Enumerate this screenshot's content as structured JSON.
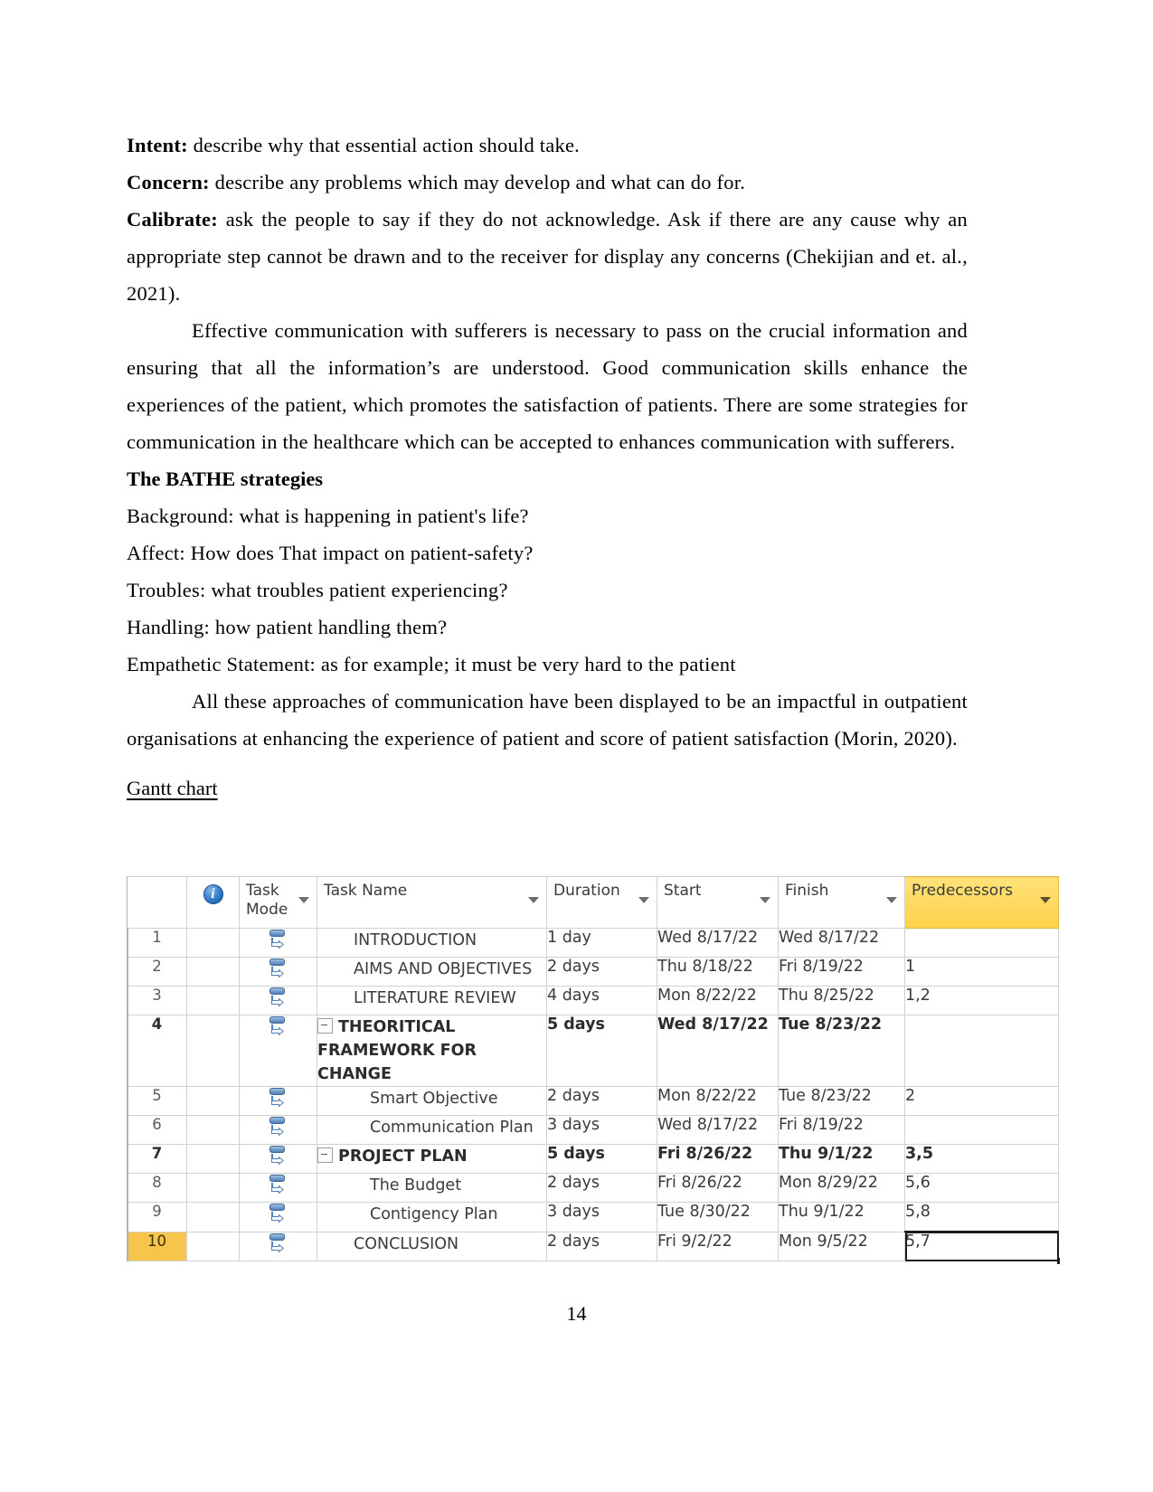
{
  "document": {
    "page_number": "14",
    "paragraphs": [
      {
        "label": "Intent:",
        "text": " describe why that essential action should take."
      },
      {
        "label": "Concern:",
        "text": " describe any problems which may develop and what can do for."
      },
      {
        "label": "Calibrate:",
        "text": " ask the people to say if they do not acknowledge. Ask if there are any cause why an appropriate step cannot be drawn and to the receiver for display any concerns (Chekijian and et. al., 2021)."
      }
    ],
    "body_paragraph_1": "Effective communication with sufferers is necessary to pass on the crucial information and ensuring that all the information’s are understood. Good communication skills enhance the experiences of the patient, which promotes the satisfaction of patients. There are some strategies for communication in the healthcare which can be accepted to enhances communication with sufferers.",
    "bathe_heading": "The BATHE strategies",
    "bathe_lines": [
      "Background: what is happening in patient's life?",
      "Affect: How does That impact on patient-safety?",
      "Troubles: what troubles patient experiencing?",
      "Handling: how patient handling them?",
      "Empathetic Statement: as for example; it must be very hard to the patient"
    ],
    "body_paragraph_2": "All these approaches of communication have been displayed to be an impactful in outpatient organisations at enhancing the experience of patient and score of patient satisfaction (Morin, 2020).",
    "gantt_label": "Gantt chart"
  },
  "project_table": {
    "columns": [
      {
        "key": "id",
        "label": ""
      },
      {
        "key": "indicator",
        "label": "",
        "icon": "info-icon"
      },
      {
        "key": "mode",
        "label": "Task\nMode",
        "has_filter": true
      },
      {
        "key": "name",
        "label": "Task Name",
        "has_filter": true
      },
      {
        "key": "duration",
        "label": "Duration",
        "has_filter": true
      },
      {
        "key": "start",
        "label": "Start",
        "has_filter": true
      },
      {
        "key": "finish",
        "label": "Finish",
        "has_filter": true
      },
      {
        "key": "predecessors",
        "label": "Predecessors",
        "has_filter": true,
        "highlight": "#ffd24a"
      }
    ],
    "rows": [
      {
        "id": "1",
        "name": "INTRODUCTION",
        "duration": "1 day",
        "start": "Wed 8/17/22",
        "finish": "Wed 8/17/22",
        "predecessors": "",
        "level": 1,
        "summary": false,
        "collapse": false
      },
      {
        "id": "2",
        "name": "AIMS AND OBJECTIVES",
        "duration": "2 days",
        "start": "Thu 8/18/22",
        "finish": "Fri 8/19/22",
        "predecessors": "1",
        "level": 1,
        "summary": false,
        "collapse": false
      },
      {
        "id": "3",
        "name": "LITERATURE REVIEW",
        "duration": "4 days",
        "start": "Mon 8/22/22",
        "finish": "Thu 8/25/22",
        "predecessors": "1,2",
        "level": 1,
        "summary": false,
        "collapse": false
      },
      {
        "id": "4",
        "name": "THEORITICAL FRAMEWORK FOR CHANGE",
        "duration": "5 days",
        "start": "Wed 8/17/22",
        "finish": "Tue 8/23/22",
        "predecessors": "",
        "level": 0,
        "summary": true,
        "collapse": true
      },
      {
        "id": "5",
        "name": "Smart Objective",
        "duration": "2 days",
        "start": "Mon 8/22/22",
        "finish": "Tue 8/23/22",
        "predecessors": "2",
        "level": 2,
        "summary": false,
        "collapse": false
      },
      {
        "id": "6",
        "name": "Communication Plan",
        "duration": "3 days",
        "start": "Wed 8/17/22",
        "finish": "Fri 8/19/22",
        "predecessors": "",
        "level": 2,
        "summary": false,
        "collapse": false
      },
      {
        "id": "7",
        "name": "PROJECT PLAN",
        "duration": "5 days",
        "start": "Fri 8/26/22",
        "finish": "Thu 9/1/22",
        "predecessors": "3,5",
        "level": 0,
        "summary": true,
        "collapse": true
      },
      {
        "id": "8",
        "name": "The Budget",
        "duration": "2 days",
        "start": "Fri 8/26/22",
        "finish": "Mon 8/29/22",
        "predecessors": "5,6",
        "level": 2,
        "summary": false,
        "collapse": false
      },
      {
        "id": "9",
        "name": "Contigency Plan",
        "duration": "3 days",
        "start": "Tue 8/30/22",
        "finish": "Thu 9/1/22",
        "predecessors": "5,8",
        "level": 2,
        "summary": false,
        "collapse": false
      },
      {
        "id": "10",
        "name": "CONCLUSION",
        "duration": "2 days",
        "start": "Fri 9/2/22",
        "finish": "Mon 9/5/22",
        "predecessors": "5,7",
        "level": 1,
        "summary": false,
        "collapse": false,
        "row_selected": true,
        "cell_selected": "predecessors"
      }
    ]
  }
}
